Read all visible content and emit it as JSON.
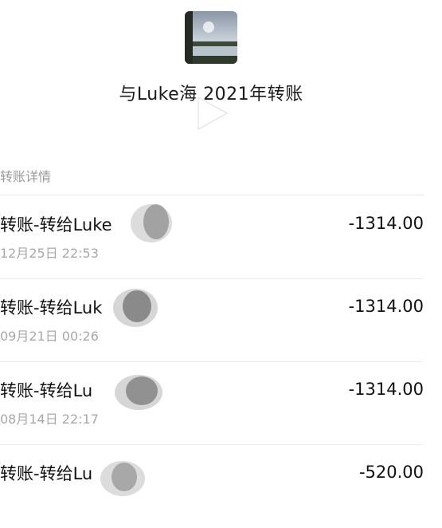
{
  "header": {
    "title": "与Luke海 2021年转账"
  },
  "section": {
    "label": "转账详情"
  },
  "transactions": [
    {
      "name": "转账-转给Luke",
      "date": "12月25日 22:53",
      "amount": "-1314.00"
    },
    {
      "name": "转账-转给Luk",
      "date": "09月21日 00:26",
      "amount": "-1314.00"
    },
    {
      "name": "转账-转给Lu",
      "date": "08月14日 22:17",
      "amount": "-1314.00"
    },
    {
      "name": "转账-转给Lu",
      "date": "",
      "amount": "-520.00"
    }
  ],
  "colors": {
    "text": "#111111",
    "secondary": "#a8a8a8",
    "divider": "#e8e8e8"
  }
}
